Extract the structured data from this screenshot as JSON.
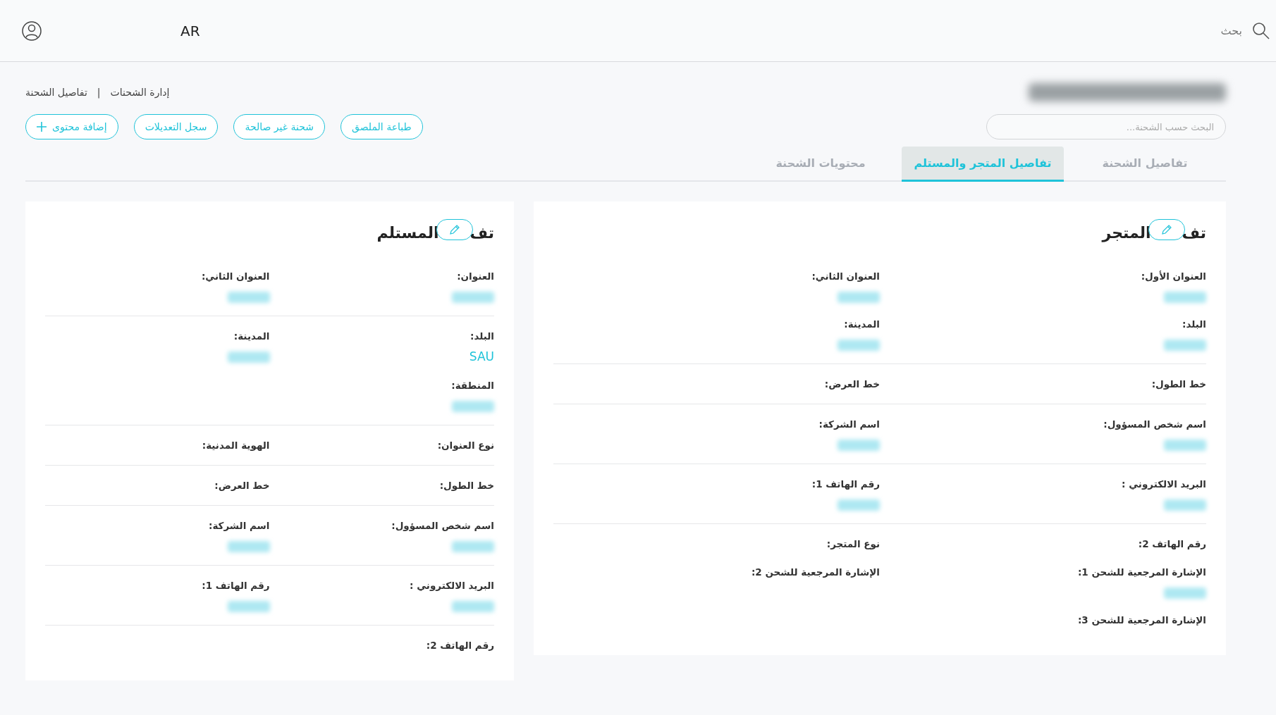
{
  "header": {
    "language": "AR",
    "search_label": "بحث"
  },
  "breadcrumb": {
    "items": [
      {
        "label": "إدارة الشحنات"
      },
      {
        "label": "تفاصيل الشحنة"
      }
    ],
    "separator": "|"
  },
  "shipment_id": {
    "blurred": true
  },
  "search": {
    "placeholder": "البحث حسب الشحنة..."
  },
  "actions": [
    {
      "label": "طباعة الملصق",
      "kind": "plain"
    },
    {
      "label": "شحنة غير صالحة",
      "kind": "plain"
    },
    {
      "label": "سجل التعديلات",
      "kind": "plain"
    },
    {
      "label": "إضافة محتوى",
      "kind": "add"
    }
  ],
  "tabs": [
    {
      "label": "تفاصيل الشحنة",
      "selected": false
    },
    {
      "label": "تفاصيل المتجر والمستلم",
      "selected": true
    },
    {
      "label": "محتويات الشحنة",
      "selected": false
    }
  ],
  "cards": [
    {
      "title_parts": [
        "تف",
        "المتجر"
      ],
      "sections": [
        {
          "fields": [
            {
              "label": "العنوان الأول:",
              "blurred": true
            },
            {
              "label": "العنوان الثاني:",
              "blurred": true
            },
            {
              "label": "البلد:",
              "blurred": true
            },
            {
              "label": "المدينة:",
              "blurred": true
            }
          ]
        },
        {
          "fields": [
            {
              "label": "خط الطول:",
              "blurred": false
            },
            {
              "label": "خط العرض:",
              "blurred": false
            }
          ]
        },
        {
          "fields": [
            {
              "label": "اسم شخص المسؤول:",
              "blurred": true
            },
            {
              "label": "اسم الشركة:",
              "blurred": true
            }
          ]
        },
        {
          "fields": [
            {
              "label": "البريد الالكتروني :",
              "blurred": true
            },
            {
              "label": "رقم الهاتف 1:",
              "blurred": true
            }
          ]
        },
        {
          "fields": [
            {
              "label": "رقم الهاتف 2:",
              "blurred": false
            },
            {
              "label": "نوع المتجر:",
              "blurred": false
            },
            {
              "label": "الإشارة المرجعية للشحن 1:",
              "blurred": true
            },
            {
              "label": "الإشارة المرجعية للشحن 2:",
              "blurred": false
            },
            {
              "label": "الإشارة المرجعية للشحن 3:",
              "blurred": false
            }
          ]
        }
      ]
    },
    {
      "title_parts": [
        "تف",
        "المستلم"
      ],
      "sections": [
        {
          "fields": [
            {
              "label": "العنوان:",
              "blurred": true
            },
            {
              "label": "العنوان الثاني:",
              "blurred": true
            }
          ]
        },
        {
          "fields": [
            {
              "label": "البلد:",
              "value": "SAU",
              "blurred": false
            },
            {
              "label": "المدينة:",
              "blurred": true
            },
            {
              "label": "المنطقة:",
              "blurred": true
            }
          ]
        },
        {
          "fields": [
            {
              "label": "نوع العنوان:",
              "blurred": false
            },
            {
              "label": "الهوية المدنية:",
              "blurred": false
            }
          ]
        },
        {
          "fields": [
            {
              "label": "خط الطول:",
              "blurred": false
            },
            {
              "label": "خط العرض:",
              "blurred": false
            }
          ]
        },
        {
          "fields": [
            {
              "label": "اسم شخص المسؤول:",
              "blurred": true
            },
            {
              "label": "اسم الشركة:",
              "blurred": true
            }
          ]
        },
        {
          "fields": [
            {
              "label": "البريد الالكتروني :",
              "blurred": true
            },
            {
              "label": "رقم الهاتف 1:",
              "blurred": true
            }
          ]
        },
        {
          "fields": [
            {
              "label": "رقم الهاتف 2:",
              "blurred": false
            }
          ]
        }
      ]
    }
  ]
}
